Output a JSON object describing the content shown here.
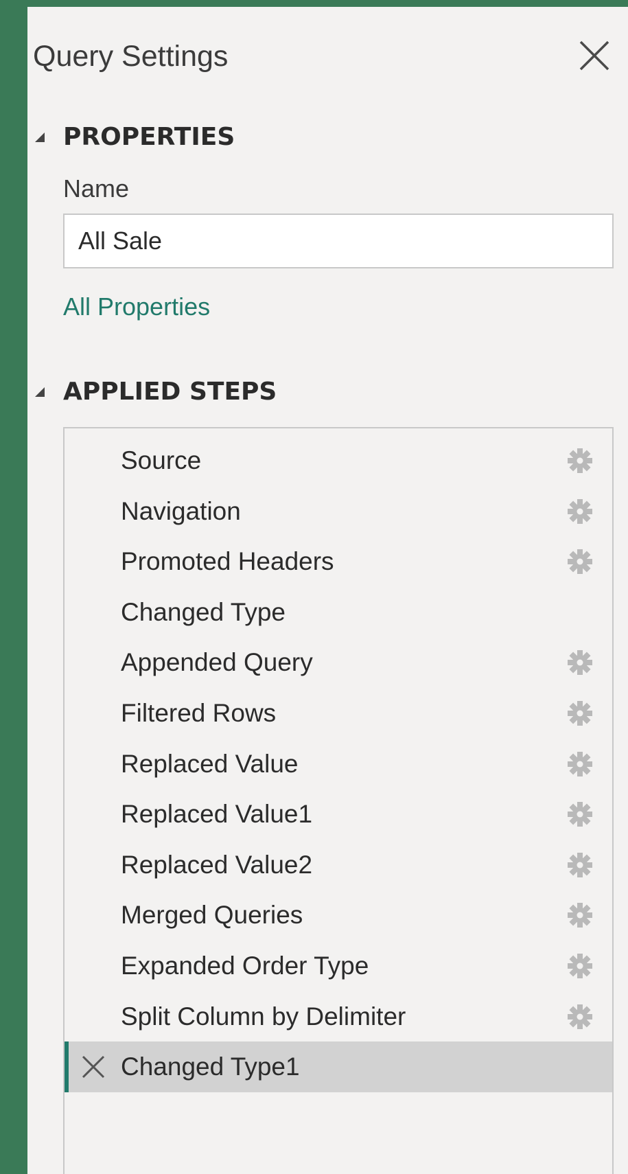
{
  "header": {
    "title": "Query Settings",
    "close_icon": "close-icon"
  },
  "properties": {
    "section_title": "PROPERTIES",
    "name_label": "Name",
    "name_value": "All Sale",
    "all_properties_link": "All Properties"
  },
  "applied_steps": {
    "section_title": "APPLIED STEPS",
    "selected_index": 12,
    "steps": [
      {
        "label": "Source",
        "has_settings": true
      },
      {
        "label": "Navigation",
        "has_settings": true
      },
      {
        "label": "Promoted Headers",
        "has_settings": true
      },
      {
        "label": "Changed Type",
        "has_settings": false
      },
      {
        "label": "Appended Query",
        "has_settings": true
      },
      {
        "label": "Filtered Rows",
        "has_settings": true
      },
      {
        "label": "Replaced Value",
        "has_settings": true
      },
      {
        "label": "Replaced Value1",
        "has_settings": true
      },
      {
        "label": "Replaced Value2",
        "has_settings": true
      },
      {
        "label": "Merged Queries",
        "has_settings": true
      },
      {
        "label": "Expanded Order Type",
        "has_settings": true
      },
      {
        "label": "Split Column by Delimiter",
        "has_settings": true
      },
      {
        "label": "Changed Type1",
        "has_settings": false
      }
    ]
  },
  "colors": {
    "background": "#3a7a57",
    "panel": "#f3f2f1",
    "accent": "#217a6b",
    "selected_row": "#d2d2d2"
  }
}
